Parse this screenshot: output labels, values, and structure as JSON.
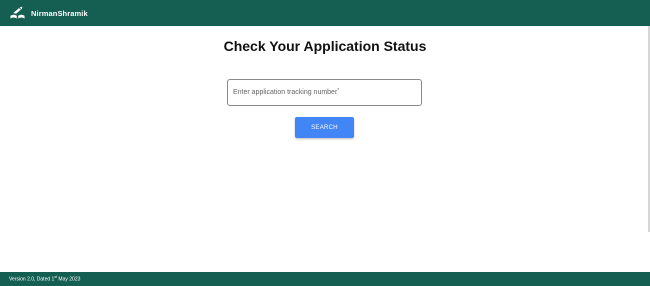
{
  "header": {
    "brand": "NirmanShramik",
    "logo_icon": "hand-book-icon",
    "background": "#155e52"
  },
  "main": {
    "title": "Check Your Application Status",
    "tracking_field": {
      "placeholder": "Enter application tracking number",
      "required_marker": "*",
      "value": ""
    },
    "search_button": {
      "label": "SEARCH",
      "color": "#4285f4"
    }
  },
  "footer": {
    "version_text": "Version 2.0, Dated 1",
    "date_superscript": "st",
    "date_rest": " May 2023"
  }
}
